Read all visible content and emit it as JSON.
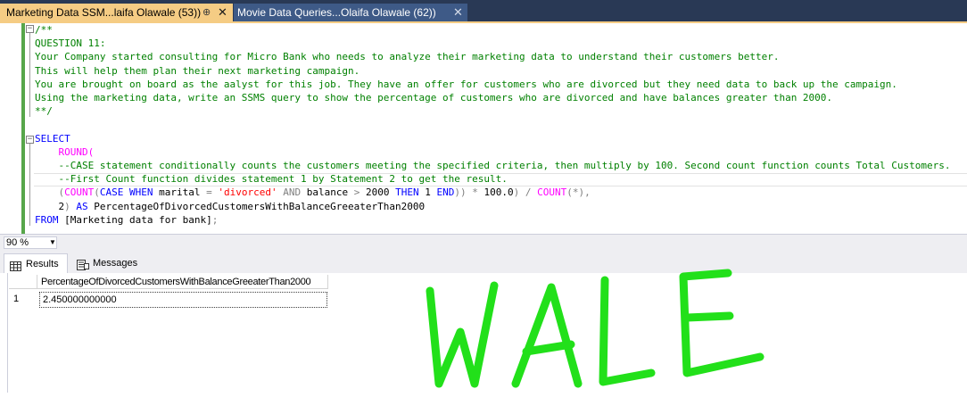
{
  "tabs": [
    {
      "label": "Marketing Data SSM...laifa Olawale (53))",
      "pin": "⊕",
      "close": "✕"
    },
    {
      "label": "Movie Data Queries...Olaifa Olawale (62))",
      "close": "✕"
    }
  ],
  "editor": {
    "comment_lines": [
      "/**",
      "QUESTION 11:",
      "Your Company started consulting for Micro Bank who needs to analyze their marketing data to understand their customers better.",
      "This will help them plan their next marketing campaign.",
      "You are brought on board as the aalyst for this job. They have an offer for customers who are divorced but they need data to back up the campaign.",
      "Using the marketing data, write an SSMS query to show the percentage of customers who are divorced and have balances greater than 2000.",
      "**/"
    ],
    "select_kw": "SELECT",
    "round_fn": "ROUND(",
    "case_comment": "--CASE statement conditionally counts the customers meeting the specified criteria, then multiply by 100. Second count function counts Total Customers.",
    "first_comment": "--First Count function divides statement 1 by Statement 2 to get the result.",
    "expr": {
      "open": "(",
      "count1": "COUNT",
      "open2": "(",
      "case_kw": "CASE",
      "when_kw": "WHEN",
      "col1": "marital",
      "eq": "=",
      "divorced": "'divorced'",
      "and_kw": "AND",
      "col2": "balance",
      "gt": ">",
      "num2000": "2000",
      "then_kw": "THEN",
      "num1": "1",
      "end_kw": "END",
      "close": "))",
      "mul": "*",
      "num100": "100.0",
      "close2": ")",
      "div": "/",
      "count2": "COUNT",
      "star": "(*)",
      "comma": ","
    },
    "alias_line": {
      "num": "2",
      "close": ")",
      "as_kw": "AS",
      "alias": "PercentageOfDivorcedCustomersWithBalanceGreeaterThan2000"
    },
    "from_line": {
      "from_kw": "FROM",
      "table": "[Marketing data for bank]",
      "semi": ";"
    }
  },
  "zoom": {
    "value": "90 %"
  },
  "result_tabs": {
    "results": "Results",
    "messages": "Messages"
  },
  "grid": {
    "column": "PercentageOfDivorcedCustomersWithBalanceGreeaterThan2000",
    "rows": [
      {
        "num": "1",
        "value": "2.450000000000"
      }
    ]
  },
  "watermark": {
    "text": "WALE",
    "color": "#22e01a"
  }
}
